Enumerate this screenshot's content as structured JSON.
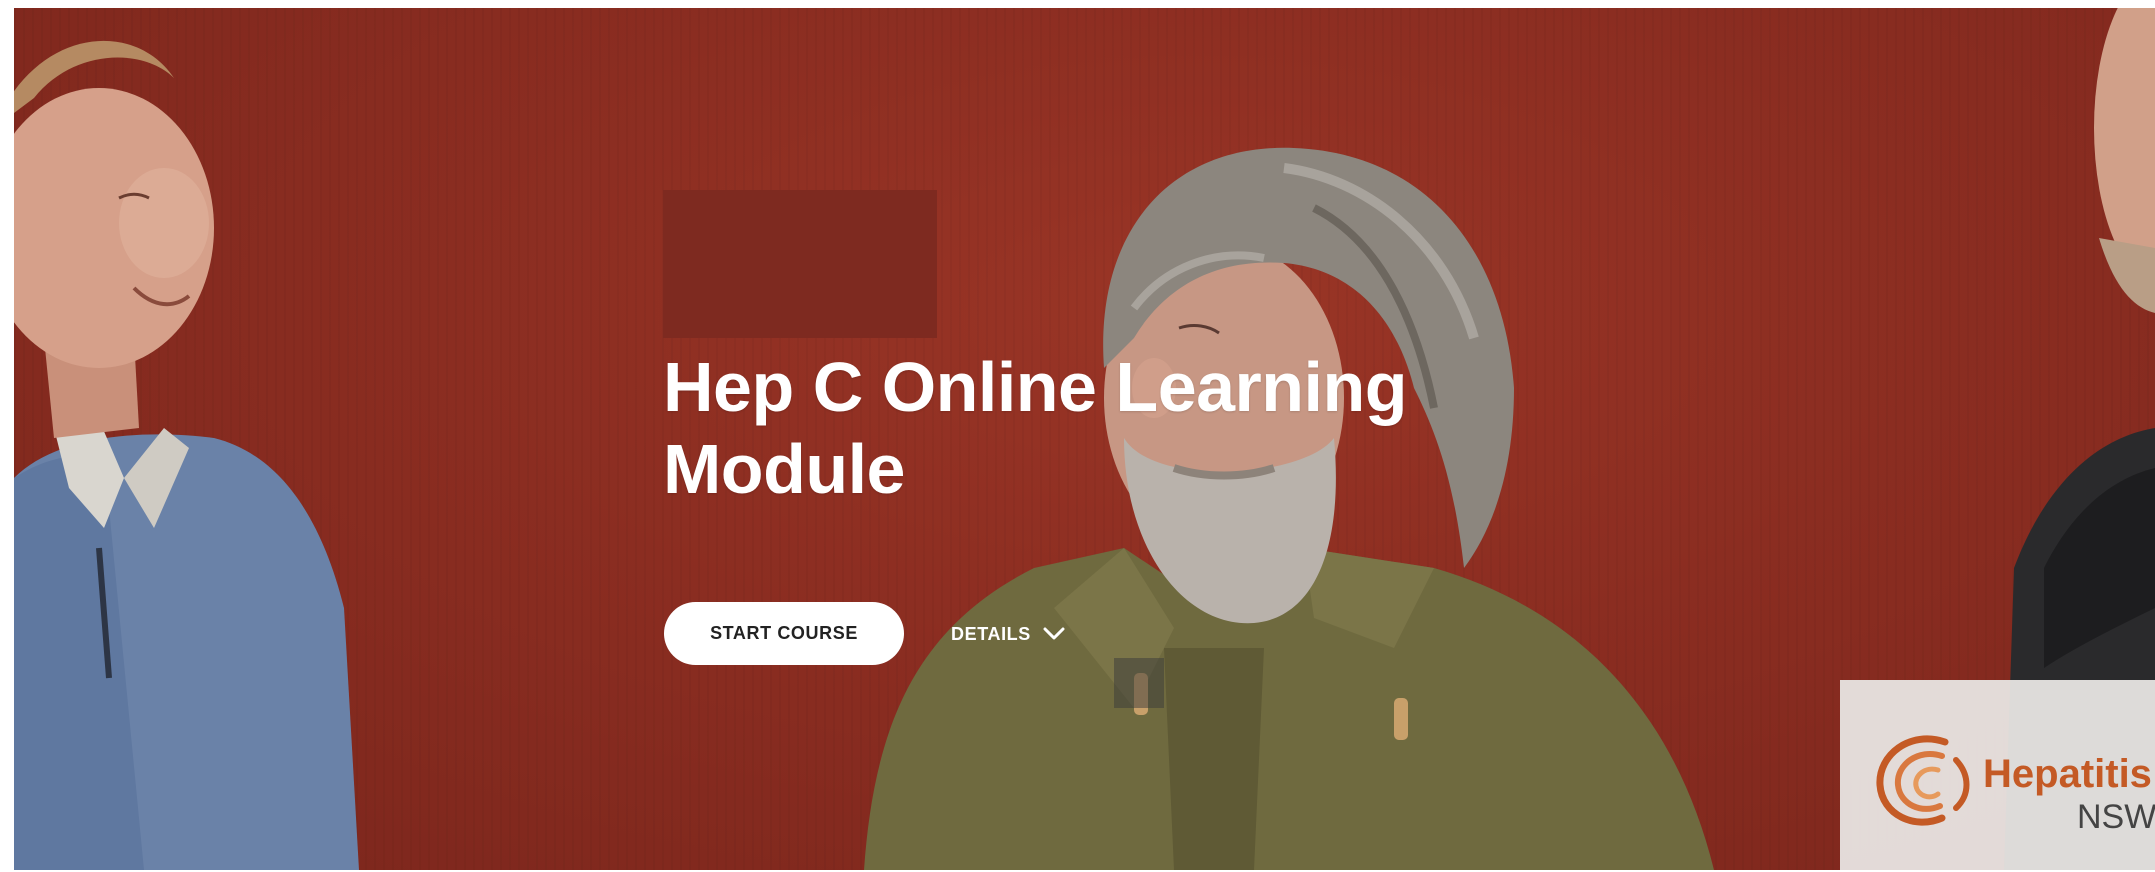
{
  "hero": {
    "title": "Hep C Online Learning Module",
    "background_color": "#8a2e22",
    "photo_subjects": "three men talking in front of a red wall"
  },
  "actions": {
    "start_course_label": "START COURSE",
    "details_label": "DETAILS",
    "details_icon": "chevron-down-icon"
  },
  "logo": {
    "word": "Hepatitis",
    "sub": "NSW",
    "icon": "hepatitis-nsw-logo-mark",
    "accent_color": "#c45a25"
  }
}
